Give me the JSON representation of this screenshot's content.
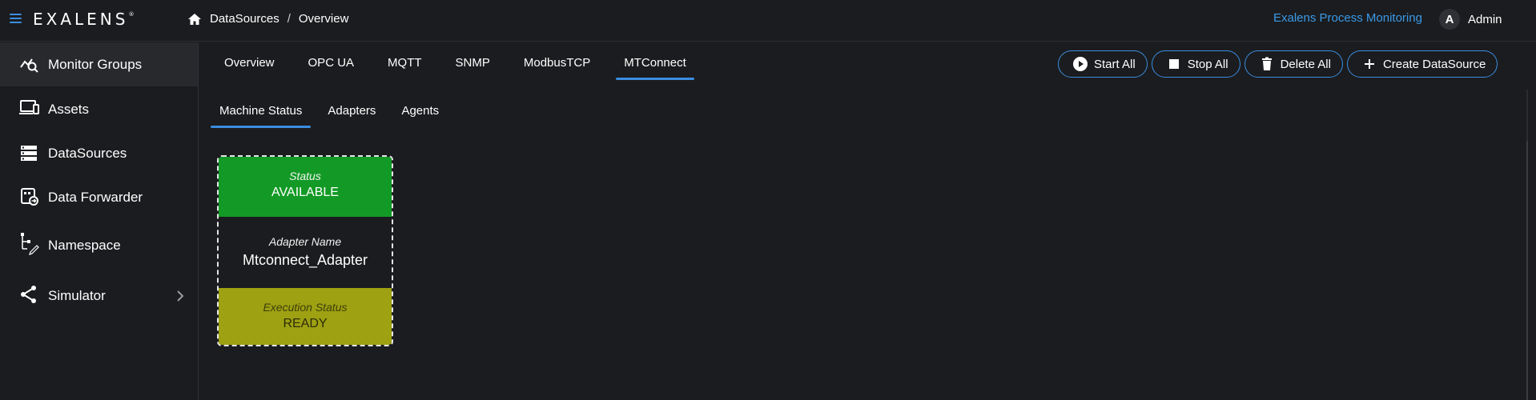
{
  "header": {
    "logo": "EXALENS",
    "logo_mark": "®",
    "breadcrumb": [
      "DataSources",
      "Overview"
    ],
    "breadcrumb_separator": "/",
    "app_link": "Exalens Process Monitoring",
    "user": {
      "avatar_letter": "A",
      "name": "Admin"
    }
  },
  "sidebar": {
    "items": [
      {
        "label": "Monitor Groups",
        "icon": "monitor-groups-icon",
        "active": true
      },
      {
        "label": "Assets",
        "icon": "assets-icon"
      },
      {
        "label": "DataSources",
        "icon": "datasources-icon"
      },
      {
        "label": "Data Forwarder",
        "icon": "data-forwarder-icon"
      },
      {
        "label": "Namespace",
        "icon": "namespace-icon"
      },
      {
        "label": "Simulator",
        "icon": "simulator-icon",
        "expandable": true
      }
    ]
  },
  "tabs": [
    {
      "label": "Overview"
    },
    {
      "label": "OPC UA"
    },
    {
      "label": "MQTT"
    },
    {
      "label": "SNMP"
    },
    {
      "label": "ModbusTCP"
    },
    {
      "label": "MTConnect",
      "active": true
    }
  ],
  "subtabs": [
    {
      "label": "Machine Status",
      "active": true
    },
    {
      "label": "Adapters"
    },
    {
      "label": "Agents"
    }
  ],
  "actions": {
    "start_all": "Start All",
    "stop_all": "Stop All",
    "delete_all": "Delete All",
    "create_datasource": "Create DataSource"
  },
  "card": {
    "status_caption": "Status",
    "status_value": "AVAILABLE",
    "adapter_caption": "Adapter Name",
    "adapter_value": "Mtconnect_Adapter",
    "exec_caption": "Execution Status",
    "exec_value": "READY"
  },
  "colors": {
    "accent": "#3a8de0",
    "link": "#3a9ae8",
    "status_available": "#139a26",
    "execution_ready": "#9ea112",
    "background": "#1b1c1f"
  }
}
